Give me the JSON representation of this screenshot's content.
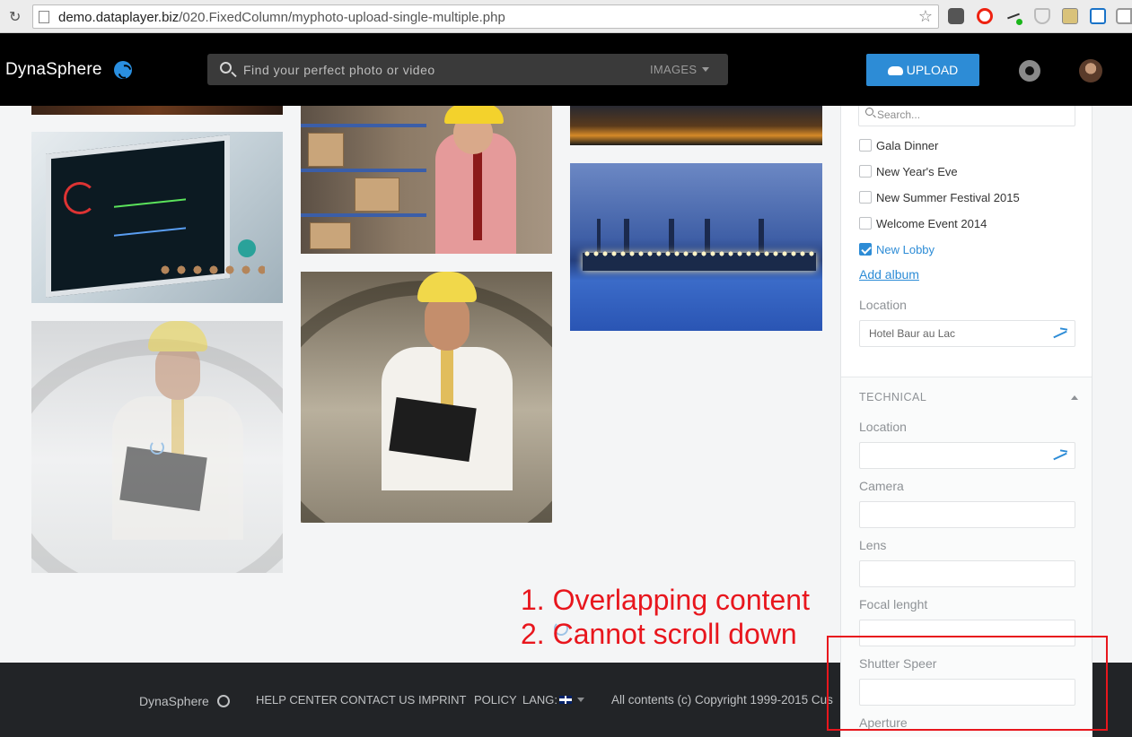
{
  "browser": {
    "url_host": "demo.dataplayer.biz",
    "url_path": "/020.FixedColumn/myphoto-upload-single-multiple.php",
    "reload_icon": "reload-icon",
    "bookmark_icon": "star-icon"
  },
  "header": {
    "logo": "DynaSphere",
    "search_placeholder": "Find your perfect photo or video",
    "search_filter": "IMAGES",
    "upload_label": "UPLOAD",
    "colors": {
      "bar": "#000000",
      "upload": "#2d8cd6"
    }
  },
  "panel": {
    "album_search_placeholder": "Search...",
    "albums": [
      {
        "label": "Gala Dinner",
        "checked": false
      },
      {
        "label": "New Year's Eve",
        "checked": false
      },
      {
        "label": "New Summer Festival 2015",
        "checked": false
      },
      {
        "label": "Welcome Event 2014",
        "checked": false
      },
      {
        "label": "New Lobby",
        "checked": true
      }
    ],
    "add_album": "Add album",
    "location_label": "Location",
    "location_value": "Hotel Baur au Lac",
    "technical_title": "TECHNICAL",
    "technical_fields": [
      {
        "label": "Location",
        "value": ""
      },
      {
        "label": "Camera",
        "value": ""
      },
      {
        "label": "Lens",
        "value": ""
      },
      {
        "label": "Focal lenght",
        "value": ""
      },
      {
        "label": "Shutter Speer",
        "value": ""
      },
      {
        "label": "Aperture",
        "value": ""
      }
    ]
  },
  "annotations": {
    "line1": "1. Overlapping content",
    "line2": "2. Cannot scroll down",
    "color": "#e8161d"
  },
  "footer": {
    "logo": "DynaSphere",
    "links": [
      "HELP CENTER",
      "CONTACT US",
      "IMPRINT",
      "POLICY"
    ],
    "lang": "LANG:",
    "copyright": "All contents (c) Copyright 1999-2015 Cus"
  }
}
